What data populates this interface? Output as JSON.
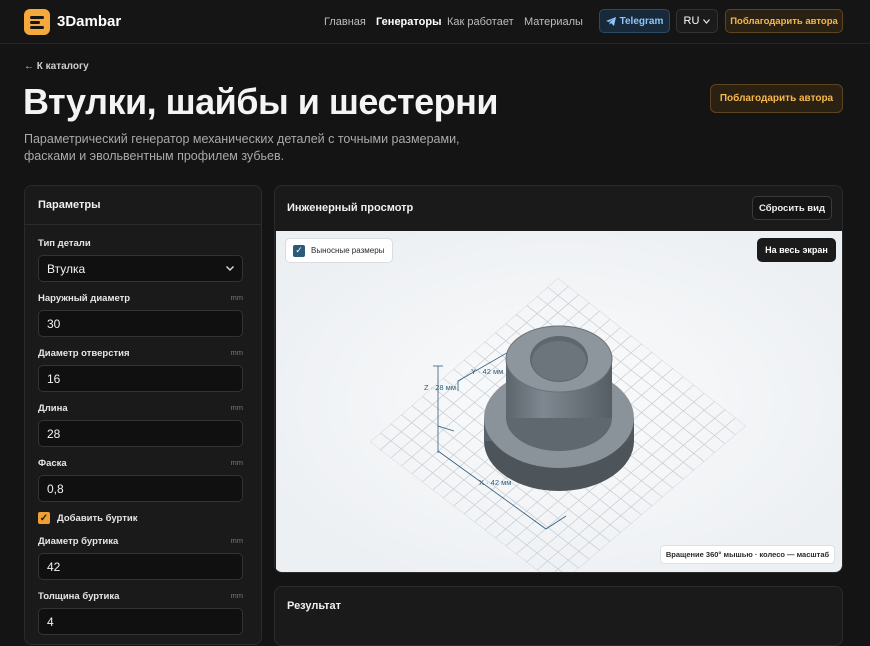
{
  "header": {
    "brand": "3Dambar",
    "nav": [
      "Главная",
      "Генераторы",
      "Как работает",
      "Материалы"
    ],
    "active_nav": "Генераторы",
    "telegram_label": "Telegram",
    "lang": "RU",
    "thank_label": "Поблагодарить автора"
  },
  "page": {
    "back_link": "← К каталогу",
    "title": "Втулки, шайбы и шестерни",
    "thank_label": "Поблагодарить автора",
    "subtitle": "Параметрический генератор механических деталей с точными размерами, фасками и эвольвентным профилем зубьев."
  },
  "params": {
    "title": "Параметры",
    "part_type_label": "Тип детали",
    "part_type_value": "Втулка",
    "fields": [
      {
        "label": "Наружный диаметр",
        "unit": "mm",
        "value": "30"
      },
      {
        "label": "Диаметр отверстия",
        "unit": "mm",
        "value": "16"
      },
      {
        "label": "Длина",
        "unit": "mm",
        "value": "28"
      },
      {
        "label": "Фаска",
        "unit": "mm",
        "value": "0,8"
      }
    ],
    "collar_checkbox": "Добавить буртик",
    "collar_checked": true,
    "collar_fields": [
      {
        "label": "Диаметр буртика",
        "unit": "mm",
        "value": "42"
      },
      {
        "label": "Толщина буртика",
        "unit": "mm",
        "value": "4"
      }
    ]
  },
  "viewer": {
    "title": "Инженерный просмотр",
    "reset_label": "Сбросить вид",
    "dims_toggle_label": "Выносные размеры",
    "dims_checked": true,
    "fullscreen_label": "На весь экран",
    "hint": "Вращение 360° мышью · колесо — масштаб",
    "dim_x": "X · 42 мм",
    "dim_y": "Y · 42 мм",
    "dim_z": "Z · 28 мм"
  },
  "result": {
    "title": "Результат"
  },
  "colors": {
    "accent": "#f5a93a",
    "telegram": "#8fc4ff",
    "part_body": "#6f787f"
  }
}
